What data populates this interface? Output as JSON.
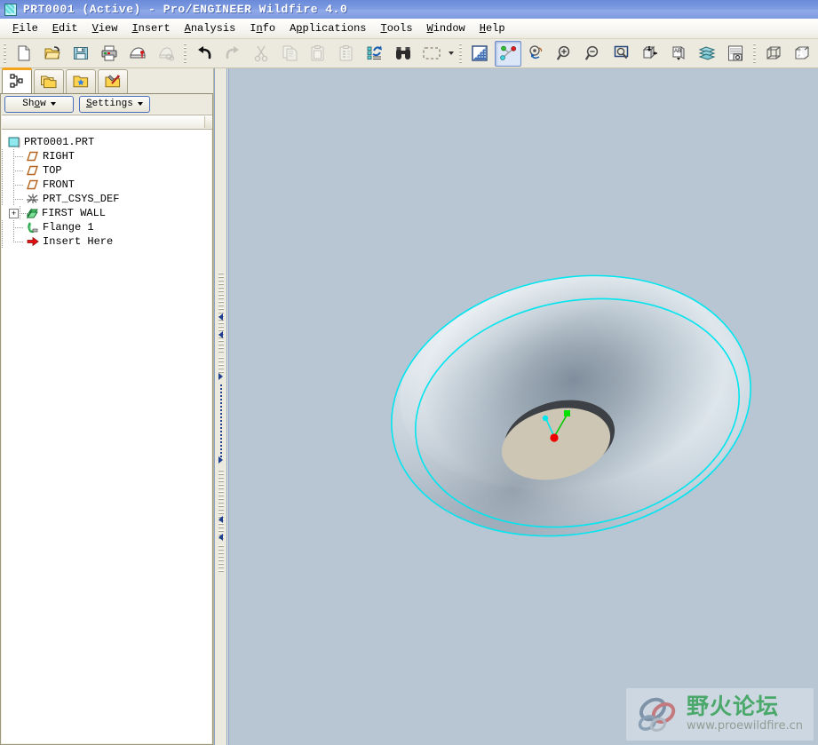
{
  "window": {
    "title": "PRT0001 (Active) - Pro/ENGINEER Wildfire 4.0",
    "icon": "part-model-icon"
  },
  "menubar": {
    "items": [
      {
        "label": "File",
        "mnemonic": "F"
      },
      {
        "label": "Edit",
        "mnemonic": "E"
      },
      {
        "label": "View",
        "mnemonic": "V"
      },
      {
        "label": "Insert",
        "mnemonic": "I"
      },
      {
        "label": "Analysis",
        "mnemonic": "A"
      },
      {
        "label": "Info",
        "mnemonic": "n"
      },
      {
        "label": "Applications",
        "mnemonic": "p"
      },
      {
        "label": "Tools",
        "mnemonic": "T"
      },
      {
        "label": "Window",
        "mnemonic": "W"
      },
      {
        "label": "Help",
        "mnemonic": "H"
      }
    ]
  },
  "toolbar": {
    "groups": [
      {
        "name": "file-group",
        "buttons": [
          {
            "name": "new-button",
            "icon": "new-document-icon",
            "state": "enabled"
          },
          {
            "name": "open-button",
            "icon": "open-folder-icon",
            "state": "enabled"
          },
          {
            "name": "save-button",
            "icon": "floppy-disk-icon",
            "state": "enabled"
          },
          {
            "name": "print-button",
            "icon": "printer-icon",
            "state": "enabled"
          },
          {
            "name": "send-mail-button",
            "icon": "envelope-icon",
            "state": "enabled"
          },
          {
            "name": "send-link-button",
            "icon": "envelope-link-icon",
            "state": "disabled"
          }
        ]
      },
      {
        "name": "edit-group",
        "buttons": [
          {
            "name": "undo-button",
            "icon": "undo-arrow-icon",
            "state": "enabled"
          },
          {
            "name": "redo-button",
            "icon": "redo-arrow-icon",
            "state": "disabled"
          },
          {
            "name": "cut-button",
            "icon": "scissors-icon",
            "state": "disabled"
          },
          {
            "name": "copy-button",
            "icon": "copy-pages-icon",
            "state": "disabled"
          },
          {
            "name": "paste-button",
            "icon": "clipboard-icon",
            "state": "disabled"
          },
          {
            "name": "paste-special-button",
            "icon": "clipboard-list-icon",
            "state": "disabled"
          },
          {
            "name": "regenerate-button",
            "icon": "regenerate-icon",
            "state": "enabled"
          },
          {
            "name": "find-button",
            "icon": "binoculars-icon",
            "state": "enabled"
          },
          {
            "name": "selection-filter-button",
            "icon": "selection-marquee-icon",
            "state": "enabled"
          }
        ]
      },
      {
        "name": "view-group",
        "buttons": [
          {
            "name": "repaint-button",
            "icon": "repaint-icon",
            "state": "enabled"
          },
          {
            "name": "datum-display-button",
            "icon": "datum-axes-icon",
            "state": "pressed"
          },
          {
            "name": "spin-center-button",
            "icon": "spin-center-icon",
            "state": "enabled"
          },
          {
            "name": "zoom-in-button",
            "icon": "magnifier-plus-icon",
            "state": "enabled"
          },
          {
            "name": "zoom-out-button",
            "icon": "magnifier-minus-icon",
            "state": "enabled"
          },
          {
            "name": "refit-button",
            "icon": "refit-magnifier-icon",
            "state": "enabled"
          },
          {
            "name": "reorient-button",
            "icon": "reorient-view-icon",
            "state": "enabled"
          },
          {
            "name": "annotation-button",
            "icon": "annotation-ab-icon",
            "state": "enabled"
          },
          {
            "name": "layers-button",
            "icon": "layers-stack-icon",
            "state": "enabled"
          },
          {
            "name": "view-manager-button",
            "icon": "view-manager-icon",
            "state": "enabled"
          }
        ]
      },
      {
        "name": "display-style-group",
        "buttons": [
          {
            "name": "wireframe-button",
            "icon": "cube-wireframe-icon",
            "state": "enabled"
          },
          {
            "name": "hidden-line-button",
            "icon": "cube-hidden-line-icon",
            "state": "enabled"
          },
          {
            "name": "no-hidden-button",
            "icon": "cube-no-hidden-icon",
            "state": "enabled"
          },
          {
            "name": "shading-button",
            "icon": "cube-shaded-icon",
            "state": "pressed"
          }
        ]
      },
      {
        "name": "datum-group",
        "buttons": [
          {
            "name": "datum-plane-display-button",
            "icon": "datum-plane-eye-icon",
            "state": "enabled"
          }
        ]
      }
    ]
  },
  "navigator": {
    "tabs": [
      {
        "name": "model-tree-tab",
        "icon": "model-tree-icon",
        "active": true
      },
      {
        "name": "folder-browser-tab",
        "icon": "folders-icon",
        "active": false
      },
      {
        "name": "favorites-tab",
        "icon": "folder-star-icon",
        "active": false
      },
      {
        "name": "connections-tab",
        "icon": "folder-tools-icon",
        "active": false
      }
    ],
    "buttons": {
      "show": {
        "label": "Show",
        "mnemonic": "w"
      },
      "settings": {
        "label": "Settings",
        "mnemonic": "S"
      }
    },
    "tree": [
      {
        "label": "PRT0001.PRT",
        "icon": "part-model-icon",
        "depth": 0,
        "expander": null,
        "last": false
      },
      {
        "label": "RIGHT",
        "icon": "datum-plane-icon",
        "depth": 1,
        "expander": null,
        "last": false
      },
      {
        "label": "TOP",
        "icon": "datum-plane-icon",
        "depth": 1,
        "expander": null,
        "last": false
      },
      {
        "label": "FRONT",
        "icon": "datum-plane-icon",
        "depth": 1,
        "expander": null,
        "last": false
      },
      {
        "label": "PRT_CSYS_DEF",
        "icon": "coord-system-icon",
        "depth": 1,
        "expander": null,
        "last": false
      },
      {
        "label": "FIRST WALL",
        "icon": "first-wall-icon",
        "depth": 1,
        "expander": "+",
        "last": false
      },
      {
        "label": "Flange 1",
        "icon": "flange-icon",
        "depth": 1,
        "expander": null,
        "last": false
      },
      {
        "label": "Insert Here",
        "icon": "insert-here-arrow-icon",
        "depth": 1,
        "expander": null,
        "last": true
      }
    ]
  },
  "sash": {
    "name": "navigator-graphics-splitter",
    "arrows": [
      "left",
      "left",
      "right",
      "right",
      "left",
      "left"
    ]
  },
  "graphics": {
    "background_color": "#b8c6d4",
    "model": {
      "name": "sheet-metal-funnel",
      "highlight_color": "#00e5ee",
      "surface_color": "#cfd9e2",
      "flange_face_color": "#cdc6b4",
      "rim_color": "#3d4044",
      "selected_edges": 2
    },
    "csys": {
      "name": "coordinate-system-marker",
      "origin_color": "#ee0000",
      "axis1_color": "#00e000",
      "axis2_color": "#00e5ee"
    },
    "watermark": {
      "text_cn": "野火论坛",
      "url": "www.proewildfire.cn"
    }
  }
}
